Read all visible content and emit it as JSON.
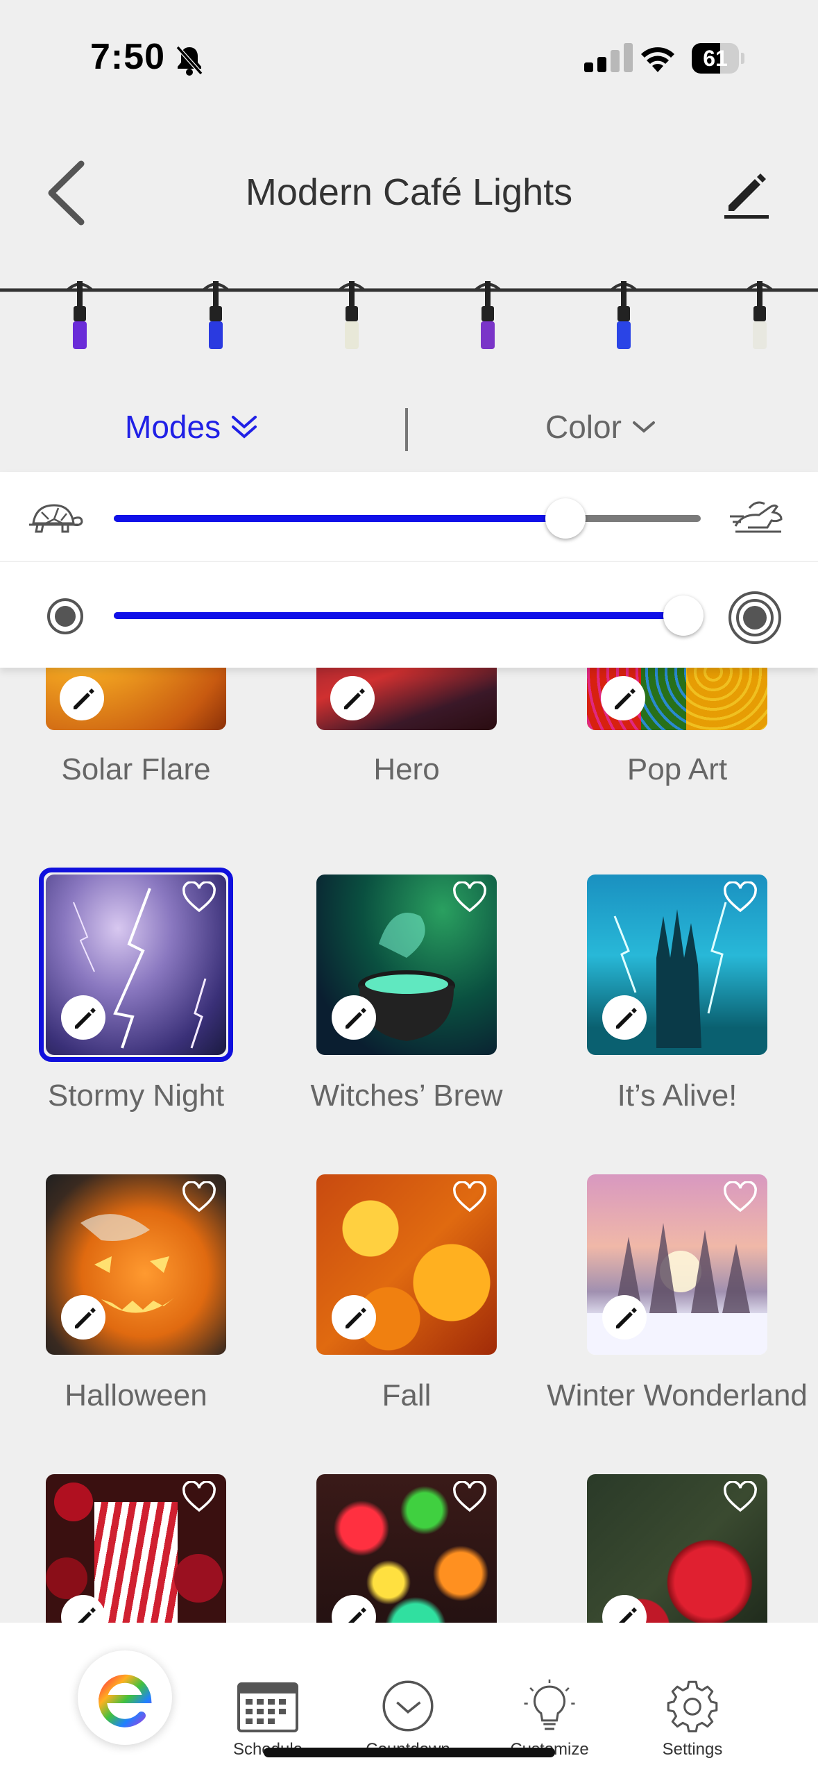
{
  "status": {
    "time": "7:50",
    "battery": "61",
    "battery_level": 0.61
  },
  "header": {
    "title": "Modern Café Lights"
  },
  "tabs": {
    "modes": "Modes",
    "color": "Color"
  },
  "sliders": {
    "speed": 0.77,
    "size": 0.97
  },
  "accent": "#1010e8",
  "bulbs": [
    "#6a2cd8",
    "#2a3ae0",
    "#e8e8d8",
    "#7a34c8",
    "#2a44e6",
    "#e8e8e0"
  ],
  "modes": [
    {
      "label": "Solar Flare",
      "selected": false
    },
    {
      "label": "Hero",
      "selected": false
    },
    {
      "label": "Pop Art",
      "selected": false
    },
    {
      "label": "Stormy Night",
      "selected": true
    },
    {
      "label": "Witches’ Brew",
      "selected": false
    },
    {
      "label": "It’s Alive!",
      "selected": false
    },
    {
      "label": "Halloween",
      "selected": false
    },
    {
      "label": "Fall",
      "selected": false
    },
    {
      "label": "Winter Wonderland",
      "selected": false
    },
    {
      "label": "",
      "selected": false
    },
    {
      "label": "",
      "selected": false
    },
    {
      "label": "",
      "selected": false
    }
  ],
  "tabbar": {
    "schedule": "Schedule",
    "countdown": "Countdown",
    "customize": "Customize",
    "settings": "Settings"
  }
}
